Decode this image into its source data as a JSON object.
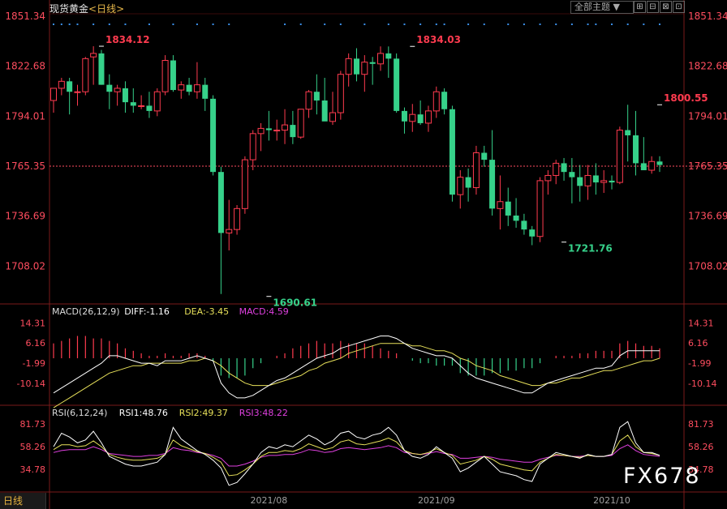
{
  "header": {
    "title": "现货黄金",
    "period": "<日线>",
    "theme_label": "全部主题",
    "window_buttons": [
      "⊞",
      "⊟",
      "⊠",
      "⊡"
    ]
  },
  "bottom_tab": "日线",
  "watermark": "FX678",
  "colors": {
    "up": "#ff3b4f",
    "down": "#36d18a",
    "white": "#ffffff",
    "yellow": "#e7e05a",
    "magenta": "#e040e0",
    "price_axis": "#ff4d5f",
    "marker": "#3a8ee6"
  },
  "chart_data": [
    {
      "type": "candlestick",
      "title": "现货黄金",
      "y_ticks": [
        1851.34,
        1822.68,
        1794.01,
        1765.35,
        1736.69,
        1708.02
      ],
      "ylim": [
        1694.2,
        1851.34
      ],
      "current_price": 1765.35,
      "x_labels": [
        {
          "index": 27,
          "label": "2021/08"
        },
        {
          "index": 48,
          "label": "2021/09"
        },
        {
          "index": 70,
          "label": "2021/10"
        }
      ],
      "annotations": [
        {
          "label": "1834.12",
          "index": 6,
          "value": 1834.12,
          "kind": "high"
        },
        {
          "label": "1834.03",
          "index": 45,
          "value": 1834.03,
          "kind": "high"
        },
        {
          "label": "1690.61",
          "index": 27,
          "value": 1690.61,
          "kind": "low"
        },
        {
          "label": "1721.76",
          "index": 64,
          "value": 1721.76,
          "kind": "low"
        },
        {
          "label": "1800.55",
          "index": 76,
          "value": 1800.55,
          "kind": "high"
        }
      ],
      "candles": [
        [
          1803,
          1810,
          1796,
          1810
        ],
        [
          1810,
          1816,
          1806,
          1814
        ],
        [
          1814,
          1816,
          1795,
          1808
        ],
        [
          1808,
          1812,
          1800,
          1808
        ],
        [
          1808,
          1828,
          1806,
          1827
        ],
        [
          1828,
          1834.12,
          1812,
          1830
        ],
        [
          1830,
          1832,
          1812,
          1812
        ],
        [
          1812,
          1818,
          1798,
          1808
        ],
        [
          1808,
          1812,
          1800,
          1810
        ],
        [
          1810,
          1814,
          1796,
          1802
        ],
        [
          1802,
          1810,
          1796,
          1800
        ],
        [
          1800,
          1806,
          1798,
          1800
        ],
        [
          1800,
          1808,
          1793,
          1797
        ],
        [
          1797,
          1810,
          1794,
          1808
        ],
        [
          1808,
          1829,
          1806,
          1826
        ],
        [
          1826,
          1829,
          1808,
          1809
        ],
        [
          1809,
          1814,
          1804,
          1812
        ],
        [
          1812,
          1816,
          1806,
          1808
        ],
        [
          1808,
          1825,
          1804,
          1812
        ],
        [
          1812,
          1816,
          1797,
          1804
        ],
        [
          1804,
          1806,
          1760,
          1762
        ],
        [
          1762,
          1765,
          1692,
          1727
        ],
        [
          1727,
          1746,
          1717,
          1729
        ],
        [
          1729,
          1743,
          1726,
          1741
        ],
        [
          1741,
          1771,
          1738,
          1769
        ],
        [
          1769,
          1786,
          1763,
          1784
        ],
        [
          1784,
          1790,
          1774,
          1787
        ],
        [
          1787,
          1797,
          1780,
          1786
        ],
        [
          1786,
          1792,
          1780,
          1786
        ],
        [
          1786,
          1798,
          1778,
          1789
        ],
        [
          1789,
          1797,
          1778,
          1782
        ],
        [
          1782,
          1798,
          1781,
          1798
        ],
        [
          1798,
          1809,
          1793,
          1808
        ],
        [
          1808,
          1818,
          1795,
          1803
        ],
        [
          1803,
          1816,
          1793,
          1791
        ],
        [
          1791,
          1808,
          1789,
          1796
        ],
        [
          1796,
          1820,
          1792,
          1818
        ],
        [
          1818,
          1830,
          1811,
          1827
        ],
        [
          1827,
          1833,
          1814,
          1818
        ],
        [
          1818,
          1829,
          1808,
          1825
        ],
        [
          1825,
          1828,
          1812,
          1824
        ],
        [
          1824,
          1834.03,
          1820,
          1830
        ],
        [
          1830,
          1834,
          1816,
          1827
        ],
        [
          1827,
          1830,
          1796,
          1797
        ],
        [
          1797,
          1799,
          1784,
          1791
        ],
        [
          1791,
          1801,
          1785,
          1795
        ],
        [
          1795,
          1803,
          1789,
          1790
        ],
        [
          1790,
          1800,
          1785,
          1797
        ],
        [
          1797,
          1811,
          1793,
          1808
        ],
        [
          1808,
          1810,
          1795,
          1798
        ],
        [
          1798,
          1800,
          1745,
          1749
        ],
        [
          1749,
          1763,
          1741,
          1759
        ],
        [
          1759,
          1764,
          1745,
          1753
        ],
        [
          1753,
          1777,
          1749,
          1773
        ],
        [
          1773,
          1777,
          1765,
          1769
        ],
        [
          1769,
          1786,
          1737,
          1741
        ],
        [
          1741,
          1760,
          1729,
          1745
        ],
        [
          1745,
          1753,
          1731,
          1737
        ],
        [
          1737,
          1747,
          1730,
          1734
        ],
        [
          1734,
          1738,
          1726,
          1729
        ],
        [
          1729,
          1731,
          1720,
          1725
        ],
        [
          1725,
          1759,
          1721.76,
          1757
        ],
        [
          1757,
          1763,
          1749,
          1760
        ],
        [
          1760,
          1769,
          1755,
          1767
        ],
        [
          1767,
          1770,
          1757,
          1762
        ],
        [
          1762,
          1770,
          1744,
          1759
        ],
        [
          1759,
          1766,
          1745,
          1754
        ],
        [
          1754,
          1766,
          1746,
          1760
        ],
        [
          1760,
          1767,
          1749,
          1756
        ],
        [
          1756,
          1763,
          1750,
          1757
        ],
        [
          1757,
          1760,
          1752,
          1756
        ],
        [
          1756,
          1788,
          1755,
          1786
        ],
        [
          1786,
          1800.55,
          1768,
          1783
        ],
        [
          1783,
          1797,
          1760,
          1767
        ],
        [
          1767,
          1782,
          1765,
          1763
        ],
        [
          1763,
          1771,
          1761,
          1768
        ],
        [
          1768,
          1771,
          1762,
          1766
        ]
      ]
    },
    {
      "type": "bar+line",
      "title": "MACD(26,12,9)",
      "legend": [
        {
          "label": "DIFF:-1.16",
          "color": "#ffffff"
        },
        {
          "label": "DEA:-3.45",
          "color": "#e7e05a"
        },
        {
          "label": "MACD:4.59",
          "color": "#e040e0"
        }
      ],
      "y_ticks": [
        14.31,
        6.16,
        -1.99,
        -10.14
      ],
      "ylim": [
        -18,
        18
      ],
      "diff": [
        -14,
        -12,
        -10,
        -8,
        -6,
        -4,
        -2,
        1,
        1,
        0,
        -1,
        -2,
        -2,
        -3,
        -1,
        -1,
        -1,
        0,
        1,
        0,
        -1,
        -10,
        -14,
        -16,
        -16,
        -15,
        -13,
        -11,
        -9,
        -8,
        -6,
        -4,
        -2,
        0,
        1,
        2,
        4,
        5,
        6,
        7,
        8,
        9,
        9,
        8,
        6,
        4,
        3,
        2,
        1,
        1,
        0,
        -3,
        -6,
        -8,
        -9,
        -10,
        -11,
        -12,
        -13,
        -14,
        -14,
        -12,
        -10,
        -9,
        -8,
        -7,
        -6,
        -5,
        -4,
        -4,
        -3,
        1,
        3,
        3,
        3,
        3,
        3
      ],
      "dea": [
        -20,
        -18,
        -16,
        -14,
        -12,
        -10,
        -8,
        -6,
        -5,
        -4,
        -3,
        -3,
        -2,
        -2,
        -2,
        -2,
        -2,
        -1,
        -1,
        0,
        -1,
        -3,
        -6,
        -8,
        -10,
        -11,
        -11,
        -11,
        -10,
        -9,
        -8,
        -7,
        -5,
        -4,
        -2,
        -1,
        0,
        2,
        3,
        4,
        5,
        6,
        6,
        6,
        6,
        5,
        5,
        4,
        3,
        3,
        2,
        0,
        -1,
        -3,
        -4,
        -5,
        -7,
        -8,
        -9,
        -10,
        -11,
        -11,
        -10,
        -10,
        -9,
        -8,
        -8,
        -7,
        -6,
        -5,
        -5,
        -4,
        -3,
        -2,
        -1,
        -1,
        0
      ],
      "macd": [
        6,
        7,
        8,
        9,
        9,
        8,
        8,
        7,
        6,
        4,
        3,
        2,
        1,
        1,
        2,
        1,
        1,
        2,
        2,
        1,
        -1,
        -7,
        -8,
        -8,
        -7,
        -4,
        -2,
        0,
        1,
        2,
        4,
        5,
        6,
        7,
        6,
        6,
        7,
        6,
        6,
        6,
        5,
        4,
        3,
        2,
        0,
        -1,
        -2,
        -2,
        -3,
        -3,
        -3,
        -6,
        -7,
        -7,
        -7,
        -6,
        -6,
        -5,
        -5,
        -4,
        -4,
        -2,
        0,
        1,
        1,
        1,
        2,
        2,
        3,
        3,
        3,
        6,
        7,
        6,
        5,
        5,
        4
      ]
    },
    {
      "type": "line",
      "title": "RSI(6,12,24)",
      "legend": [
        {
          "label": "RSI1:48.76",
          "color": "#ffffff"
        },
        {
          "label": "RSI2:49.37",
          "color": "#e7e05a"
        },
        {
          "label": "RSI3:48.22",
          "color": "#e040e0"
        }
      ],
      "y_ticks": [
        81.73,
        58.26,
        34.78
      ],
      "ylim": [
        17,
        90
      ],
      "rsi1": [
        58,
        72,
        68,
        62,
        65,
        74,
        62,
        48,
        44,
        40,
        38,
        38,
        40,
        42,
        50,
        78,
        66,
        60,
        54,
        50,
        44,
        36,
        18,
        21,
        30,
        40,
        52,
        58,
        56,
        60,
        58,
        64,
        70,
        66,
        60,
        64,
        72,
        74,
        68,
        66,
        70,
        72,
        78,
        70,
        54,
        48,
        46,
        50,
        58,
        52,
        46,
        32,
        36,
        42,
        48,
        40,
        32,
        30,
        28,
        24,
        22,
        40,
        46,
        52,
        50,
        48,
        46,
        50,
        48,
        48,
        50,
        78,
        84,
        62,
        52,
        52,
        49
      ],
      "rsi2": [
        55,
        60,
        60,
        58,
        59,
        64,
        58,
        50,
        47,
        45,
        44,
        44,
        45,
        46,
        50,
        65,
        59,
        56,
        53,
        51,
        47,
        42,
        28,
        29,
        34,
        40,
        48,
        52,
        52,
        54,
        53,
        56,
        61,
        58,
        55,
        57,
        63,
        65,
        61,
        60,
        62,
        64,
        67,
        63,
        54,
        51,
        50,
        52,
        56,
        52,
        49,
        40,
        42,
        44,
        48,
        45,
        40,
        38,
        36,
        34,
        33,
        42,
        46,
        50,
        49,
        48,
        47,
        49,
        48,
        48,
        50,
        64,
        70,
        58,
        52,
        51,
        49
      ],
      "rsi3": [
        52,
        54,
        55,
        55,
        55,
        58,
        55,
        51,
        50,
        49,
        48,
        48,
        49,
        49,
        51,
        57,
        55,
        54,
        52,
        51,
        49,
        46,
        38,
        38,
        40,
        43,
        47,
        49,
        49,
        50,
        50,
        52,
        55,
        54,
        52,
        53,
        56,
        57,
        56,
        55,
        56,
        57,
        59,
        57,
        52,
        51,
        50,
        51,
        53,
        51,
        50,
        46,
        46,
        47,
        48,
        47,
        45,
        44,
        43,
        42,
        42,
        45,
        47,
        49,
        49,
        48,
        48,
        49,
        48,
        48,
        49,
        56,
        60,
        54,
        50,
        49,
        48
      ]
    }
  ]
}
